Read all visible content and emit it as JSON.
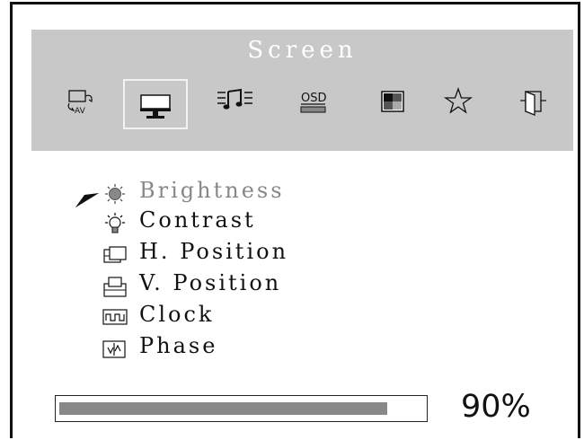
{
  "menu_title": "Screen",
  "colors": {
    "header_bg": "#c8c8c8",
    "progress_fill": "#888888",
    "active_text": "#888888"
  },
  "tabs": [
    {
      "icon": "input-source-av-icon",
      "selected": false
    },
    {
      "icon": "monitor-screen-icon",
      "selected": true
    },
    {
      "icon": "audio-music-icon",
      "selected": false
    },
    {
      "icon": "osd-settings-icon",
      "label": "OSD",
      "selected": false
    },
    {
      "icon": "color-palette-icon",
      "selected": false
    },
    {
      "icon": "star-icon",
      "selected": false
    },
    {
      "icon": "exit-door-icon",
      "selected": false
    }
  ],
  "menu_items": [
    {
      "label": "Brightness",
      "icon": "brightness-icon",
      "selected": true
    },
    {
      "label": "Contrast",
      "icon": "contrast-icon",
      "selected": false
    },
    {
      "label": "H. Position",
      "icon": "h-position-icon",
      "selected": false
    },
    {
      "label": "V. Position",
      "icon": "v-position-icon",
      "selected": false
    },
    {
      "label": "Clock",
      "icon": "clock-icon",
      "selected": false
    },
    {
      "label": "Phase",
      "icon": "phase-icon",
      "selected": false
    }
  ],
  "progress": {
    "value_label": "90%",
    "fraction": 0.9
  }
}
